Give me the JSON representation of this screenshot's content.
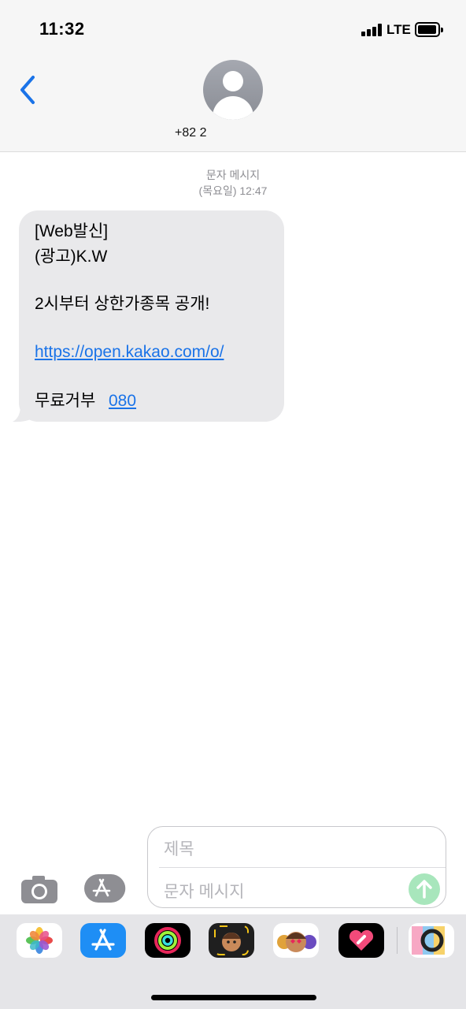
{
  "status_bar": {
    "time": "11:32",
    "network": "LTE"
  },
  "header": {
    "contact": "+82 2"
  },
  "conversation": {
    "meta_type": "문자 메시지",
    "meta_time": "(목요일) 12:47",
    "message": {
      "line1": "[Web발신]",
      "line2": "(광고)K.W",
      "line3": "2시부터 상한가종목 공개!",
      "link": "https://open.kakao.com/o/",
      "optout_label": "무료거부",
      "optout_number": "080"
    }
  },
  "composer": {
    "subject_placeholder": "제목",
    "body_placeholder": "문자 메시지"
  },
  "app_drawer": {
    "apps": [
      "photos-app-icon",
      "app-store-icon",
      "activity-icon",
      "memoji-icon",
      "animoji-stickers-icon",
      "digital-touch-icon",
      "more-apps-icon"
    ]
  },
  "colors": {
    "link": "#1a73e8",
    "bubble": "#e9e9eb",
    "send": "#a8e6bc",
    "back": "#1a73e8"
  }
}
